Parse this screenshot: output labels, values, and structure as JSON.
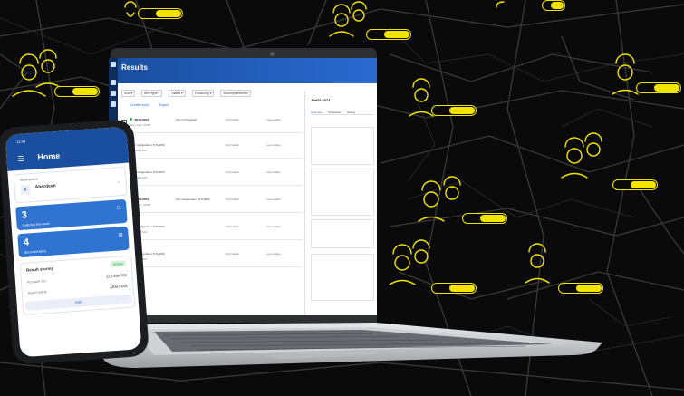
{
  "laptop_app": {
    "title": "Results",
    "toolbar": [
      "Sort ▾",
      "Item type ▾",
      "Status ▾",
      "Producing ▾",
      "Accomplishments"
    ],
    "tabs": [
      "Create report",
      "Export"
    ],
    "rows": [
      {
        "id": "J0HSL6873",
        "type": "Item type: ZCNR",
        "config": "Test in Production",
        "sub": "Standard SL0",
        "c3": "Unit builder",
        "c4": "Last update"
      },
      {
        "id": "",
        "type": "",
        "config": "Test configuration: NTL5050",
        "sub": "Standard SL0",
        "c3": "Unit builder",
        "c4": "Last update"
      },
      {
        "id": "",
        "type": "",
        "config": "Test configuration: NTL5050",
        "sub": "Standard SL0",
        "c3": "Unit builder",
        "c4": "Last update"
      },
      {
        "id": "J0HSL6873",
        "type": "Item type: ZCNR",
        "config": "Test configuration: NTL5050",
        "sub": "Standard SL0",
        "c3": "Unit builder",
        "c4": "Last update"
      },
      {
        "id": "",
        "type": "",
        "config": "Test configuration: NTL5050",
        "sub": "Standard SL0",
        "c3": "Unit builder",
        "c4": "Last update"
      },
      {
        "id": "",
        "type": "",
        "config": "Test configuration: NTL5050",
        "sub": "Standard SL0",
        "c3": "Unit builder",
        "c4": "Last update"
      }
    ],
    "detail": {
      "title": "J0HSL6873",
      "tabs": [
        "Overview",
        "Properties",
        "History"
      ]
    }
  },
  "phone_app": {
    "time": "12:48",
    "title": "Home",
    "location_label": "Workspace",
    "location_name": "Aberdeen",
    "card1_value": "3",
    "card1_label": "Collected this week",
    "card2_value": "4",
    "card2_label": "Recorded items",
    "result_title": "Result storing",
    "result_badge": "Active",
    "row1_label": "Account No.",
    "row1_value": "123-456-789",
    "row2_label": "Asset name",
    "row2_value": "ABNCHAB",
    "button": "Edit"
  },
  "colors": {
    "accent_yellow": "#f3e300",
    "app_blue": "#1a4fa0",
    "background": "#0a0a0a"
  }
}
